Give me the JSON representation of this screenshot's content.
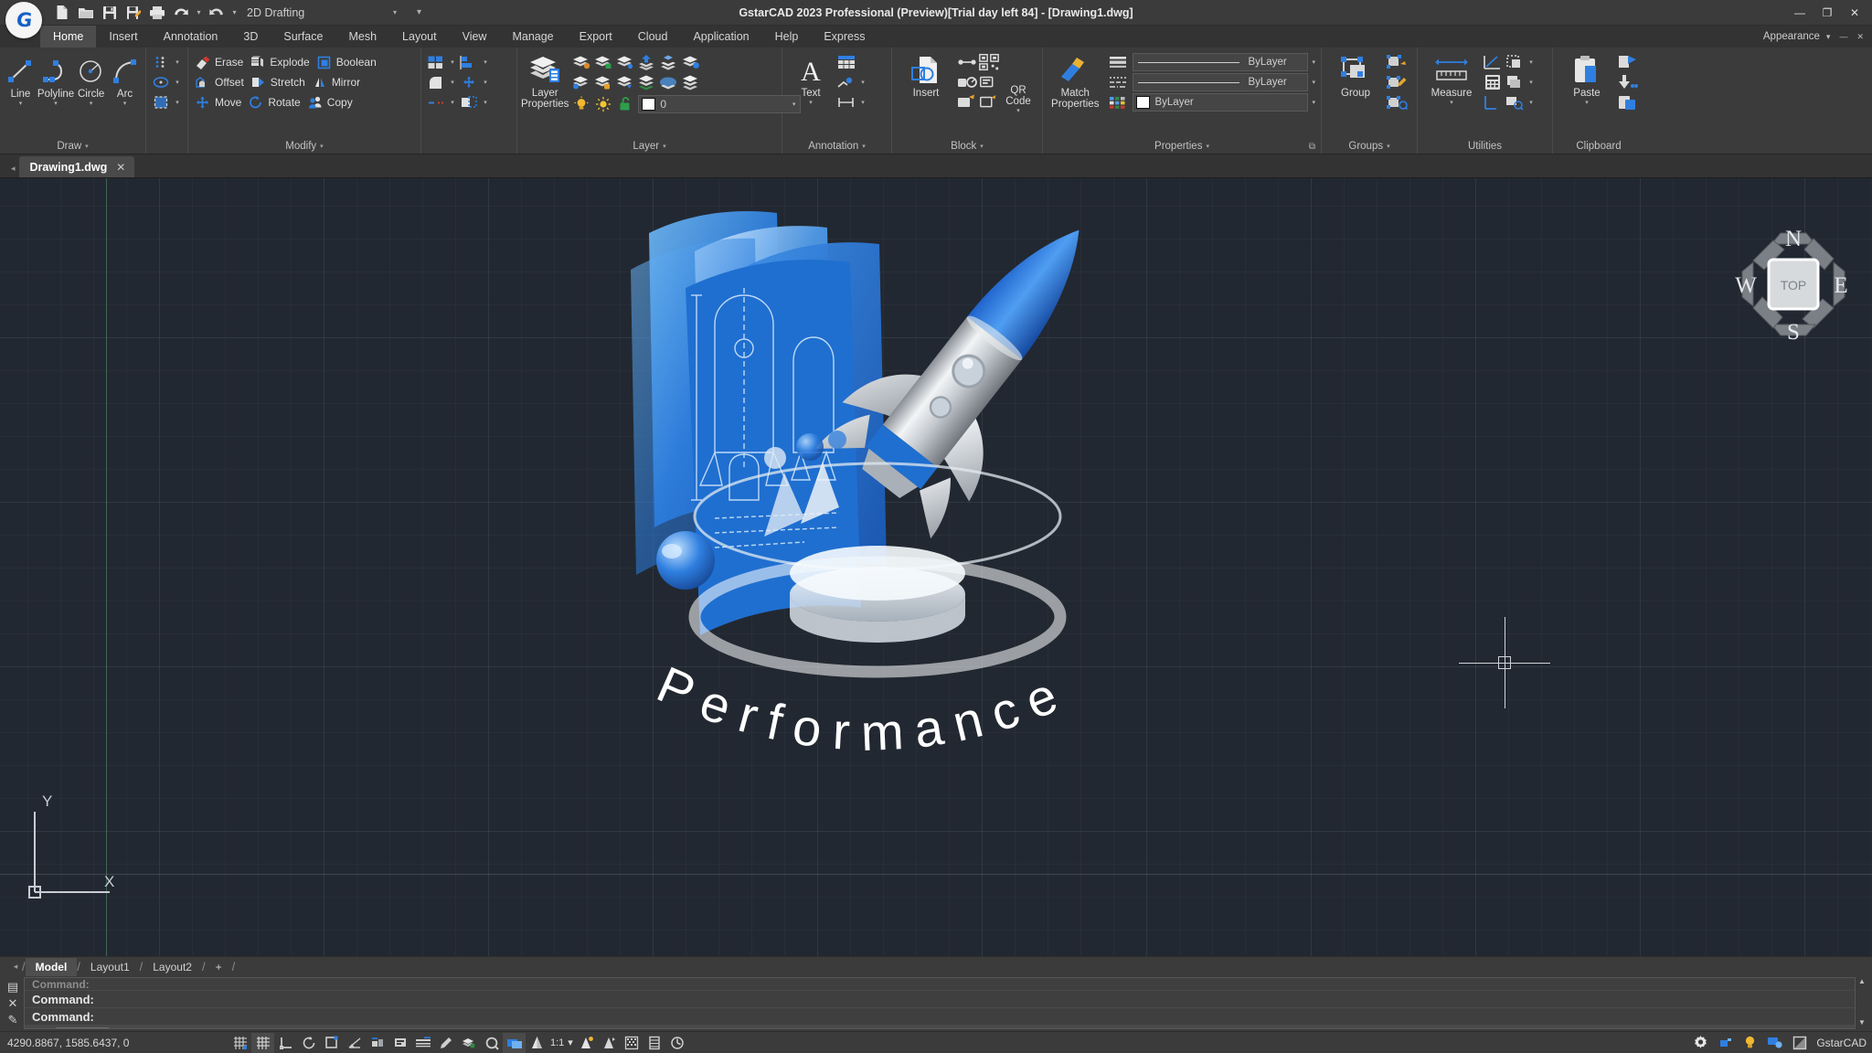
{
  "window": {
    "title": "GstarCAD 2023 Professional (Preview)[Trial day left 84] - [Drawing1.dwg]",
    "minimize": "—",
    "maximize": "❐",
    "close": "✕",
    "inner_minimize": "—",
    "inner_maximize": "❐",
    "inner_close": "✕"
  },
  "quick_access": {
    "workspace": "2D Drafting",
    "items": [
      {
        "name": "new-file-icon",
        "label": "New"
      },
      {
        "name": "open-file-icon",
        "label": "Open"
      },
      {
        "name": "save-icon",
        "label": "Save"
      },
      {
        "name": "save-as-icon",
        "label": "Save As"
      },
      {
        "name": "print-icon",
        "label": "Plot"
      },
      {
        "name": "undo-icon",
        "label": "Undo"
      },
      {
        "name": "redo-icon",
        "label": "Redo"
      }
    ],
    "more": "▾"
  },
  "ribbon_tabs": [
    {
      "label": "Home",
      "active": true
    },
    {
      "label": "Insert",
      "active": false
    },
    {
      "label": "Annotation",
      "active": false
    },
    {
      "label": "3D",
      "active": false
    },
    {
      "label": "Surface",
      "active": false
    },
    {
      "label": "Mesh",
      "active": false
    },
    {
      "label": "Layout",
      "active": false
    },
    {
      "label": "View",
      "active": false
    },
    {
      "label": "Manage",
      "active": false
    },
    {
      "label": "Export",
      "active": false
    },
    {
      "label": "Cloud",
      "active": false
    },
    {
      "label": "Application",
      "active": false
    },
    {
      "label": "Help",
      "active": false
    },
    {
      "label": "Express",
      "active": false
    }
  ],
  "appearance": {
    "label": "Appearance",
    "caret": "▾",
    "minimize": "—",
    "close": "✕"
  },
  "panels": {
    "draw": {
      "title": "Draw",
      "caret": "▾",
      "buttons": [
        {
          "label": "Line",
          "icon": "line-icon",
          "dropdown": "▾"
        },
        {
          "label": "Polyline",
          "icon": "polyline-icon",
          "dropdown": "▾"
        },
        {
          "label": "Circle",
          "icon": "circle-icon",
          "dropdown": "▾"
        },
        {
          "label": "Arc",
          "icon": "arc-icon",
          "dropdown": "▾"
        }
      ],
      "flyouts": [
        {
          "icon": "point-icon",
          "caret": "▾"
        },
        {
          "icon": "ellipse-icon",
          "caret": "▾"
        },
        {
          "icon": "hatch-icon",
          "caret": "▾"
        }
      ]
    },
    "modify": {
      "title": "Modify",
      "caret": "▾",
      "rows": [
        [
          {
            "label": "Erase",
            "icon": "erase-icon"
          },
          {
            "label": "Explode",
            "icon": "explode-icon"
          },
          {
            "label": "Boolean",
            "icon": "boolean-icon"
          }
        ],
        [
          {
            "label": "Offset",
            "icon": "offset-icon"
          },
          {
            "label": "Stretch",
            "icon": "stretch-icon"
          },
          {
            "label": "Mirror",
            "icon": "mirror-icon"
          }
        ],
        [
          {
            "label": "Move",
            "icon": "move-icon"
          },
          {
            "label": "Rotate",
            "icon": "rotate-icon"
          },
          {
            "label": "Copy",
            "icon": "copy-icon"
          }
        ]
      ],
      "flyouts_a": [
        {
          "icon": "array-icon",
          "caret": "▾"
        },
        {
          "icon": "fillet-icon",
          "caret": "▾"
        },
        {
          "icon": "trim-icon",
          "caret": "▾"
        }
      ],
      "flyouts_b": [
        {
          "icon": "align-icon",
          "caret": "▾"
        },
        {
          "icon": "scale-icon",
          "caret": "▾"
        },
        {
          "icon": "break-icon",
          "caret": "▾"
        }
      ]
    },
    "layer": {
      "title": "Layer",
      "caret": "▾",
      "main_label": "Layer Properties",
      "main_icon": "layer-properties-icon",
      "current_layer": "0",
      "combo_caret": "▾",
      "toggles": [
        {
          "icon": "lightbulb-icon",
          "name": "layer-on-toggle"
        },
        {
          "icon": "sun-icon",
          "name": "layer-freeze-toggle"
        },
        {
          "icon": "unlock-icon",
          "name": "layer-lock-toggle"
        }
      ],
      "grid_icons": [
        "layer-isolate-icon",
        "layer-unisolate-icon",
        "layer-off-icon",
        "layer-freeze-icon",
        "layer-thaw-icon",
        "layer-lock-icon",
        "layer-unlock-icon",
        "layer-match-icon",
        "layer-previous-icon",
        "layer-merge-icon",
        "layer-delete-icon",
        "layer-walk-icon"
      ]
    },
    "annotation": {
      "title": "Annotation",
      "caret": "▾",
      "main_label": "Text",
      "main_icon": "text-icon",
      "main_caret": "▾",
      "flyouts": [
        {
          "icon": "table-icon",
          "caret": ""
        },
        {
          "icon": "leader-icon",
          "caret": "▾"
        },
        {
          "icon": "dimension-icon",
          "caret": "▾"
        }
      ]
    },
    "block": {
      "title": "Block",
      "caret": "▾",
      "main_label": "Insert",
      "main_icon": "insert-block-icon",
      "qr_label": "QR Code",
      "qr_icon": "qr-code-icon",
      "qr_caret": "▾",
      "flyouts": [
        {
          "icon": "create-block-icon"
        },
        {
          "icon": "edit-block-icon"
        },
        {
          "icon": "define-attribute-icon"
        },
        {
          "icon": "block-editor-icon"
        },
        {
          "icon": "manage-attributes-icon"
        },
        {
          "icon": "sync-attributes-icon"
        }
      ]
    },
    "properties": {
      "title": "Properties",
      "caret": "▾",
      "main_label": "Match Properties",
      "main_icon": "match-properties-icon",
      "color_value": "ByLayer",
      "linetype_value": "ByLayer",
      "lineweight_value": "ByLayer",
      "dialog_launcher": "⧉"
    },
    "groups": {
      "title": "Groups",
      "caret": "▾",
      "main_label": "Group",
      "main_icon": "group-icon",
      "flyouts": [
        {
          "icon": "ungroup-icon"
        },
        {
          "icon": "group-edit-icon"
        },
        {
          "icon": "group-manager-icon"
        }
      ]
    },
    "utilities": {
      "title": "Utilities",
      "main_label": "Measure",
      "main_icon": "measure-icon",
      "main_caret": "▾",
      "flyouts": [
        {
          "icon": "measure-geometry-icon",
          "caret": "▾"
        },
        {
          "icon": "calculator-icon",
          "caret": "▾"
        },
        {
          "icon": "quick-select-icon",
          "caret": "▾"
        }
      ],
      "extra": [
        {
          "icon": "point-style-icon"
        },
        {
          "icon": "id-point-icon"
        }
      ]
    },
    "clipboard": {
      "title": "Clipboard",
      "main_label": "Paste",
      "main_icon": "paste-icon",
      "main_caret": "▾",
      "flyouts": [
        {
          "icon": "cut-icon"
        },
        {
          "icon": "copy-clip-icon"
        },
        {
          "icon": "paste-special-icon"
        }
      ]
    }
  },
  "document_tab": {
    "name": "Drawing1.dwg",
    "close": "✕",
    "nav_left": "◂"
  },
  "canvas": {
    "viewcube": {
      "top_face": "TOP",
      "north": "N",
      "east": "E",
      "south": "S",
      "west": "W"
    },
    "ucs": {
      "x_label": "X",
      "y_label": "Y"
    },
    "artwork_word": "Performance",
    "background_color": "#222831"
  },
  "layout_tabs": {
    "nav_left": "◂",
    "tabs": [
      {
        "label": "Model",
        "active": true
      },
      {
        "label": "Layout1",
        "active": false
      },
      {
        "label": "Layout2",
        "active": false
      }
    ],
    "add": "+"
  },
  "command_line": {
    "history": "Command:",
    "lines": [
      "Command:",
      "Command:"
    ],
    "scroll_up": "▲",
    "scroll_down": "▼",
    "gutter": [
      {
        "icon": "command-dock-icon"
      },
      {
        "icon": "close-icon"
      },
      {
        "icon": "edit-pencil-icon"
      }
    ],
    "hscroll_left": "◂",
    "hscroll_right": "▸"
  },
  "status_bar": {
    "coordinates": "4290.8867, 1585.6437, 0",
    "scale": "1:1",
    "scale_caret": "▾",
    "brand": "GstarCAD",
    "left_icons": [
      {
        "name": "snap-mode-icon",
        "on": false
      },
      {
        "name": "grid-display-icon",
        "on": true
      },
      {
        "name": "ortho-mode-icon",
        "on": false
      },
      {
        "name": "polar-tracking-icon",
        "on": false
      },
      {
        "name": "object-snap-icon",
        "on": false
      },
      {
        "name": "object-snap-tracking-icon",
        "on": false
      },
      {
        "name": "otrack-icon",
        "on": false
      },
      {
        "name": "dynamic-ucs-icon",
        "on": false
      },
      {
        "name": "dynamic-input-icon",
        "on": false
      },
      {
        "name": "lineweight-icon",
        "on": false
      },
      {
        "name": "transparency-icon",
        "on": false
      },
      {
        "name": "selection-cycling-icon",
        "on": false
      },
      {
        "name": "annotation-monitor-icon",
        "on": false
      },
      {
        "name": "quick-properties-icon",
        "on": true
      }
    ],
    "right_icons": [
      {
        "name": "settings-gear-icon"
      },
      {
        "name": "hardware-acceleration-icon"
      },
      {
        "name": "tips-lightbulb-icon"
      },
      {
        "name": "cleanscreen-icon"
      },
      {
        "name": "fullscreen-icon"
      }
    ]
  }
}
